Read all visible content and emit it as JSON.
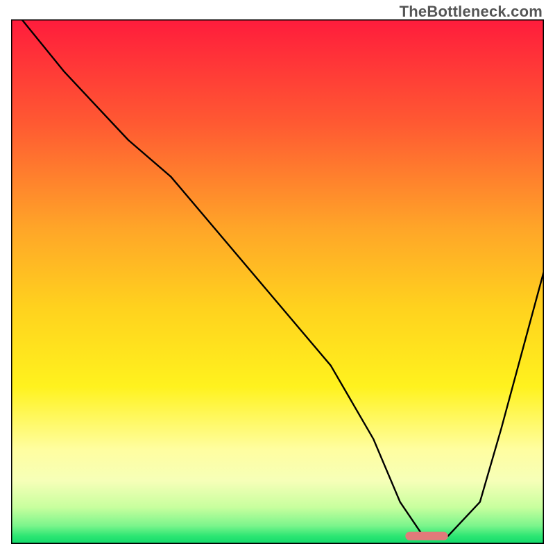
{
  "watermark": "TheBottleneck.com",
  "chart_data": {
    "type": "line",
    "title": "",
    "xlabel": "",
    "ylabel": "",
    "xlim": [
      0,
      100
    ],
    "ylim": [
      0,
      100
    ],
    "grid": false,
    "legend": false,
    "background_gradient_stops": [
      {
        "offset": 0.0,
        "color": "#ff1c3c"
      },
      {
        "offset": 0.2,
        "color": "#ff5a32"
      },
      {
        "offset": 0.4,
        "color": "#ffa628"
      },
      {
        "offset": 0.55,
        "color": "#ffd21e"
      },
      {
        "offset": 0.7,
        "color": "#fff21e"
      },
      {
        "offset": 0.82,
        "color": "#fffea0"
      },
      {
        "offset": 0.88,
        "color": "#f6ffb8"
      },
      {
        "offset": 0.93,
        "color": "#c8ff9e"
      },
      {
        "offset": 0.965,
        "color": "#7cf58c"
      },
      {
        "offset": 0.985,
        "color": "#2de673"
      },
      {
        "offset": 1.0,
        "color": "#10d96a"
      }
    ],
    "series": [
      {
        "name": "bottleneck-curve",
        "color": "#000000",
        "stroke_width": 2.4,
        "x": [
          2,
          10,
          22,
          30,
          40,
          50,
          60,
          68,
          73,
          77,
          82,
          88,
          92,
          100
        ],
        "y": [
          100,
          90,
          77,
          70,
          58,
          46,
          34,
          20,
          8,
          2,
          1.5,
          8,
          22,
          52
        ]
      }
    ],
    "marker": {
      "name": "optimal-range-marker",
      "x_center": 78,
      "y": 1.5,
      "width": 8,
      "height": 1.6,
      "color": "#e27a7a",
      "rx": 1.0
    }
  }
}
